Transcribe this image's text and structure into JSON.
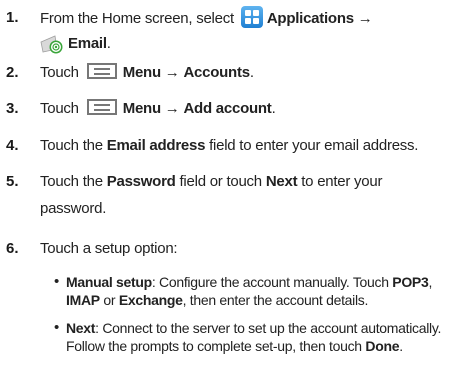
{
  "steps": [
    {
      "number": "1.",
      "line1_pre": "From the Home screen, select",
      "line1_bold": "Applications",
      "arrow": "→",
      "line2_bold": "Email",
      "line2_post": "."
    },
    {
      "number": "2.",
      "pre": "Touch",
      "menu": "Menu",
      "arrow": "→",
      "target": "Accounts",
      "post": "."
    },
    {
      "number": "3.",
      "pre": "Touch",
      "menu": "Menu",
      "arrow": "→",
      "target": "Add account",
      "post": "."
    },
    {
      "number": "4.",
      "pre": "Touch the",
      "bold": "Email address",
      "post": "field to enter your email address."
    },
    {
      "number": "5.",
      "pre": "Touch the",
      "bold1": "Password",
      "mid": "field or touch",
      "bold2": "Next",
      "post": "to enter your",
      "line2": "password."
    },
    {
      "number": "6.",
      "text": "Touch a setup option:"
    }
  ],
  "options": [
    {
      "bullet": "•",
      "title": "Manual setup",
      "text1": ": Configure the account manually. Touch",
      "b1": "POP3",
      "sep": ",",
      "b2": "IMAP",
      "or": "or",
      "b3": "Exchange",
      "text2": ", then enter the account details."
    },
    {
      "bullet": "•",
      "title": "Next",
      "text1": ": Connect to the server to set up the account automatically. Follow the prompts to complete set-up, then touch",
      "b1": "Done",
      "post": "."
    }
  ],
  "icons": {
    "applications": "applications-icon",
    "email": "email-icon",
    "menu": "menu-icon"
  },
  "colors": {
    "applications_icon": "#2b8fe0",
    "email_icon_ring": "#3aa53a",
    "menu_icon": "#777777"
  }
}
